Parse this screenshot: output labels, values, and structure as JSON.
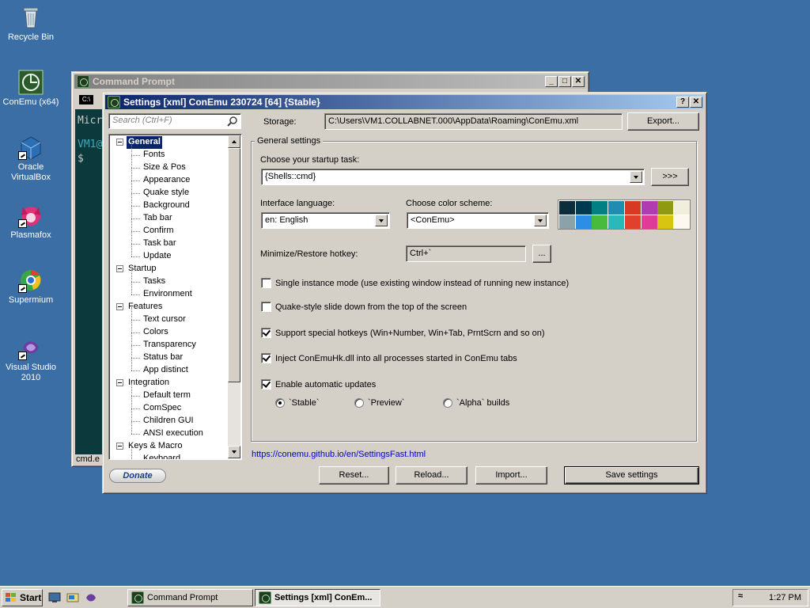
{
  "desktop": {
    "icons": [
      {
        "label": "Recycle Bin",
        "icon": "recycle-bin-icon"
      },
      {
        "label": "ConEmu (x64)",
        "icon": "conemu-icon"
      },
      {
        "label": "Oracle VirtualBox",
        "icon": "virtualbox-icon"
      },
      {
        "label": "Plasmafox",
        "icon": "plasmafox-icon"
      },
      {
        "label": "Supermium",
        "icon": "supermium-icon"
      },
      {
        "label": "Visual Studio 2010",
        "icon": "visual-studio-icon"
      }
    ]
  },
  "console_window": {
    "title": "Command Prompt",
    "tab_label": "C:\\",
    "lines": [
      "Micr",
      "VM1@",
      "$"
    ],
    "status": "cmd.e"
  },
  "settings": {
    "title": "Settings [xml] ConEmu 230724 [64] {Stable}",
    "search_placeholder": "Search (Ctrl+F)",
    "storage_label": "Storage:",
    "storage_path": "C:\\Users\\VM1.COLLABNET.000\\AppData\\Roaming\\ConEmu.xml",
    "export_label": "Export...",
    "tree": [
      {
        "label": "General",
        "level": 0,
        "selected": true
      },
      {
        "label": "Fonts",
        "level": 1
      },
      {
        "label": "Size & Pos",
        "level": 1
      },
      {
        "label": "Appearance",
        "level": 1
      },
      {
        "label": "Quake style",
        "level": 1
      },
      {
        "label": "Background",
        "level": 1
      },
      {
        "label": "Tab bar",
        "level": 1
      },
      {
        "label": "Confirm",
        "level": 1
      },
      {
        "label": "Task bar",
        "level": 1
      },
      {
        "label": "Update",
        "level": 1
      },
      {
        "label": "Startup",
        "level": 0
      },
      {
        "label": "Tasks",
        "level": 1
      },
      {
        "label": "Environment",
        "level": 1
      },
      {
        "label": "Features",
        "level": 0
      },
      {
        "label": "Text cursor",
        "level": 1
      },
      {
        "label": "Colors",
        "level": 1
      },
      {
        "label": "Transparency",
        "level": 1
      },
      {
        "label": "Status bar",
        "level": 1
      },
      {
        "label": "App distinct",
        "level": 1
      },
      {
        "label": "Integration",
        "level": 0
      },
      {
        "label": "Default term",
        "level": 1
      },
      {
        "label": "ComSpec",
        "level": 1
      },
      {
        "label": "Children GUI",
        "level": 1
      },
      {
        "label": "ANSI execution",
        "level": 1
      },
      {
        "label": "Keys & Macro",
        "level": 0
      },
      {
        "label": "Keyboard",
        "level": 1
      }
    ],
    "general": {
      "group_title": "General settings",
      "startup_task_label": "Choose your startup task:",
      "startup_task_value": "{Shells::cmd}",
      "startup_more_label": ">>>",
      "language_label": "Interface language:",
      "language_value": "en: English",
      "color_scheme_label": "Choose color scheme:",
      "color_scheme_value": "<ConEmu>",
      "palette": [
        "#0c2d3c",
        "#003a52",
        "#007f85",
        "#1f8cb0",
        "#d63a20",
        "#b13ab0",
        "#8f9a10",
        "#f2eedc",
        "#8aa2a8",
        "#2d8ee6",
        "#48ba3c",
        "#2cb8b8",
        "#e0402c",
        "#e03c96",
        "#d7c512",
        "#fcf8f0"
      ],
      "hotkey_label": "Minimize/Restore hotkey:",
      "hotkey_value": "Ctrl+`",
      "hotkey_browse": "...",
      "checks": [
        {
          "label": "Single instance mode (use existing window instead of running new instance)",
          "checked": false
        },
        {
          "label": "Quake-style slide down from the top of the screen",
          "checked": false
        },
        {
          "label": "Support special hotkeys (Win+Number, Win+Tab, PrntScrn and so on)",
          "checked": true
        },
        {
          "label": "Inject ConEmuHk.dll into all processes started in ConEmu tabs",
          "checked": true
        },
        {
          "label": "Enable automatic updates",
          "checked": true
        }
      ],
      "update_channels": [
        {
          "label": "`Stable`",
          "selected": true
        },
        {
          "label": "`Preview`",
          "selected": false
        },
        {
          "label": "`Alpha` builds",
          "selected": false
        }
      ]
    },
    "help_link": "https://conemu.github.io/en/SettingsFast.html",
    "buttons": {
      "donate": "Donate",
      "reset": "Reset...",
      "reload": "Reload...",
      "import": "Import...",
      "save": "Save settings"
    }
  },
  "taskbar": {
    "start_label": "Start",
    "tasks": [
      {
        "label": "Command Prompt",
        "active": false
      },
      {
        "label": "Settings [xml] ConEm...",
        "active": true
      }
    ],
    "clock": "1:27 PM"
  }
}
